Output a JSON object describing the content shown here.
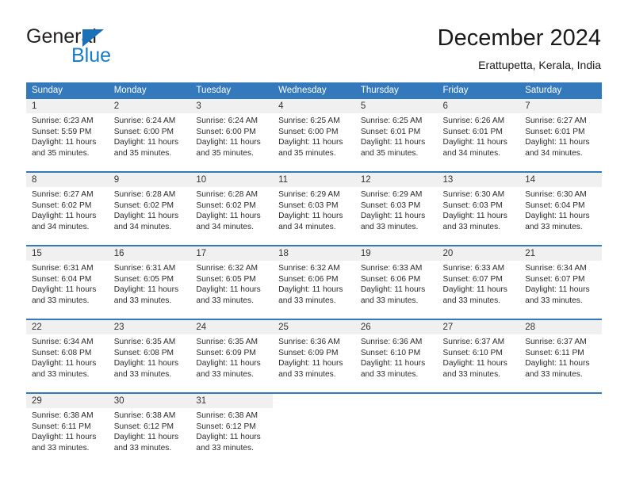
{
  "brand": {
    "name_part1": "General",
    "name_part2": "Blue",
    "triangle_icon": "triangle-icon",
    "primary_color": "#1a7ac4",
    "header_color": "#3579bd"
  },
  "header": {
    "title": "December 2024",
    "subtitle": "Erattupetta, Kerala, India"
  },
  "calendar": {
    "weekday_headers": [
      "Sunday",
      "Monday",
      "Tuesday",
      "Wednesday",
      "Thursday",
      "Friday",
      "Saturday"
    ],
    "weeks": [
      {
        "days": [
          {
            "num": "1",
            "sunrise": "Sunrise: 6:23 AM",
            "sunset": "Sunset: 5:59 PM",
            "daylight1": "Daylight: 11 hours",
            "daylight2": "and 35 minutes."
          },
          {
            "num": "2",
            "sunrise": "Sunrise: 6:24 AM",
            "sunset": "Sunset: 6:00 PM",
            "daylight1": "Daylight: 11 hours",
            "daylight2": "and 35 minutes."
          },
          {
            "num": "3",
            "sunrise": "Sunrise: 6:24 AM",
            "sunset": "Sunset: 6:00 PM",
            "daylight1": "Daylight: 11 hours",
            "daylight2": "and 35 minutes."
          },
          {
            "num": "4",
            "sunrise": "Sunrise: 6:25 AM",
            "sunset": "Sunset: 6:00 PM",
            "daylight1": "Daylight: 11 hours",
            "daylight2": "and 35 minutes."
          },
          {
            "num": "5",
            "sunrise": "Sunrise: 6:25 AM",
            "sunset": "Sunset: 6:01 PM",
            "daylight1": "Daylight: 11 hours",
            "daylight2": "and 35 minutes."
          },
          {
            "num": "6",
            "sunrise": "Sunrise: 6:26 AM",
            "sunset": "Sunset: 6:01 PM",
            "daylight1": "Daylight: 11 hours",
            "daylight2": "and 34 minutes."
          },
          {
            "num": "7",
            "sunrise": "Sunrise: 6:27 AM",
            "sunset": "Sunset: 6:01 PM",
            "daylight1": "Daylight: 11 hours",
            "daylight2": "and 34 minutes."
          }
        ]
      },
      {
        "days": [
          {
            "num": "8",
            "sunrise": "Sunrise: 6:27 AM",
            "sunset": "Sunset: 6:02 PM",
            "daylight1": "Daylight: 11 hours",
            "daylight2": "and 34 minutes."
          },
          {
            "num": "9",
            "sunrise": "Sunrise: 6:28 AM",
            "sunset": "Sunset: 6:02 PM",
            "daylight1": "Daylight: 11 hours",
            "daylight2": "and 34 minutes."
          },
          {
            "num": "10",
            "sunrise": "Sunrise: 6:28 AM",
            "sunset": "Sunset: 6:02 PM",
            "daylight1": "Daylight: 11 hours",
            "daylight2": "and 34 minutes."
          },
          {
            "num": "11",
            "sunrise": "Sunrise: 6:29 AM",
            "sunset": "Sunset: 6:03 PM",
            "daylight1": "Daylight: 11 hours",
            "daylight2": "and 34 minutes."
          },
          {
            "num": "12",
            "sunrise": "Sunrise: 6:29 AM",
            "sunset": "Sunset: 6:03 PM",
            "daylight1": "Daylight: 11 hours",
            "daylight2": "and 33 minutes."
          },
          {
            "num": "13",
            "sunrise": "Sunrise: 6:30 AM",
            "sunset": "Sunset: 6:03 PM",
            "daylight1": "Daylight: 11 hours",
            "daylight2": "and 33 minutes."
          },
          {
            "num": "14",
            "sunrise": "Sunrise: 6:30 AM",
            "sunset": "Sunset: 6:04 PM",
            "daylight1": "Daylight: 11 hours",
            "daylight2": "and 33 minutes."
          }
        ]
      },
      {
        "days": [
          {
            "num": "15",
            "sunrise": "Sunrise: 6:31 AM",
            "sunset": "Sunset: 6:04 PM",
            "daylight1": "Daylight: 11 hours",
            "daylight2": "and 33 minutes."
          },
          {
            "num": "16",
            "sunrise": "Sunrise: 6:31 AM",
            "sunset": "Sunset: 6:05 PM",
            "daylight1": "Daylight: 11 hours",
            "daylight2": "and 33 minutes."
          },
          {
            "num": "17",
            "sunrise": "Sunrise: 6:32 AM",
            "sunset": "Sunset: 6:05 PM",
            "daylight1": "Daylight: 11 hours",
            "daylight2": "and 33 minutes."
          },
          {
            "num": "18",
            "sunrise": "Sunrise: 6:32 AM",
            "sunset": "Sunset: 6:06 PM",
            "daylight1": "Daylight: 11 hours",
            "daylight2": "and 33 minutes."
          },
          {
            "num": "19",
            "sunrise": "Sunrise: 6:33 AM",
            "sunset": "Sunset: 6:06 PM",
            "daylight1": "Daylight: 11 hours",
            "daylight2": "and 33 minutes."
          },
          {
            "num": "20",
            "sunrise": "Sunrise: 6:33 AM",
            "sunset": "Sunset: 6:07 PM",
            "daylight1": "Daylight: 11 hours",
            "daylight2": "and 33 minutes."
          },
          {
            "num": "21",
            "sunrise": "Sunrise: 6:34 AM",
            "sunset": "Sunset: 6:07 PM",
            "daylight1": "Daylight: 11 hours",
            "daylight2": "and 33 minutes."
          }
        ]
      },
      {
        "days": [
          {
            "num": "22",
            "sunrise": "Sunrise: 6:34 AM",
            "sunset": "Sunset: 6:08 PM",
            "daylight1": "Daylight: 11 hours",
            "daylight2": "and 33 minutes."
          },
          {
            "num": "23",
            "sunrise": "Sunrise: 6:35 AM",
            "sunset": "Sunset: 6:08 PM",
            "daylight1": "Daylight: 11 hours",
            "daylight2": "and 33 minutes."
          },
          {
            "num": "24",
            "sunrise": "Sunrise: 6:35 AM",
            "sunset": "Sunset: 6:09 PM",
            "daylight1": "Daylight: 11 hours",
            "daylight2": "and 33 minutes."
          },
          {
            "num": "25",
            "sunrise": "Sunrise: 6:36 AM",
            "sunset": "Sunset: 6:09 PM",
            "daylight1": "Daylight: 11 hours",
            "daylight2": "and 33 minutes."
          },
          {
            "num": "26",
            "sunrise": "Sunrise: 6:36 AM",
            "sunset": "Sunset: 6:10 PM",
            "daylight1": "Daylight: 11 hours",
            "daylight2": "and 33 minutes."
          },
          {
            "num": "27",
            "sunrise": "Sunrise: 6:37 AM",
            "sunset": "Sunset: 6:10 PM",
            "daylight1": "Daylight: 11 hours",
            "daylight2": "and 33 minutes."
          },
          {
            "num": "28",
            "sunrise": "Sunrise: 6:37 AM",
            "sunset": "Sunset: 6:11 PM",
            "daylight1": "Daylight: 11 hours",
            "daylight2": "and 33 minutes."
          }
        ]
      },
      {
        "days": [
          {
            "num": "29",
            "sunrise": "Sunrise: 6:38 AM",
            "sunset": "Sunset: 6:11 PM",
            "daylight1": "Daylight: 11 hours",
            "daylight2": "and 33 minutes."
          },
          {
            "num": "30",
            "sunrise": "Sunrise: 6:38 AM",
            "sunset": "Sunset: 6:12 PM",
            "daylight1": "Daylight: 11 hours",
            "daylight2": "and 33 minutes."
          },
          {
            "num": "31",
            "sunrise": "Sunrise: 6:38 AM",
            "sunset": "Sunset: 6:12 PM",
            "daylight1": "Daylight: 11 hours",
            "daylight2": "and 33 minutes."
          },
          {
            "num": "",
            "sunrise": "",
            "sunset": "",
            "daylight1": "",
            "daylight2": ""
          },
          {
            "num": "",
            "sunrise": "",
            "sunset": "",
            "daylight1": "",
            "daylight2": ""
          },
          {
            "num": "",
            "sunrise": "",
            "sunset": "",
            "daylight1": "",
            "daylight2": ""
          },
          {
            "num": "",
            "sunrise": "",
            "sunset": "",
            "daylight1": "",
            "daylight2": ""
          }
        ]
      }
    ]
  }
}
